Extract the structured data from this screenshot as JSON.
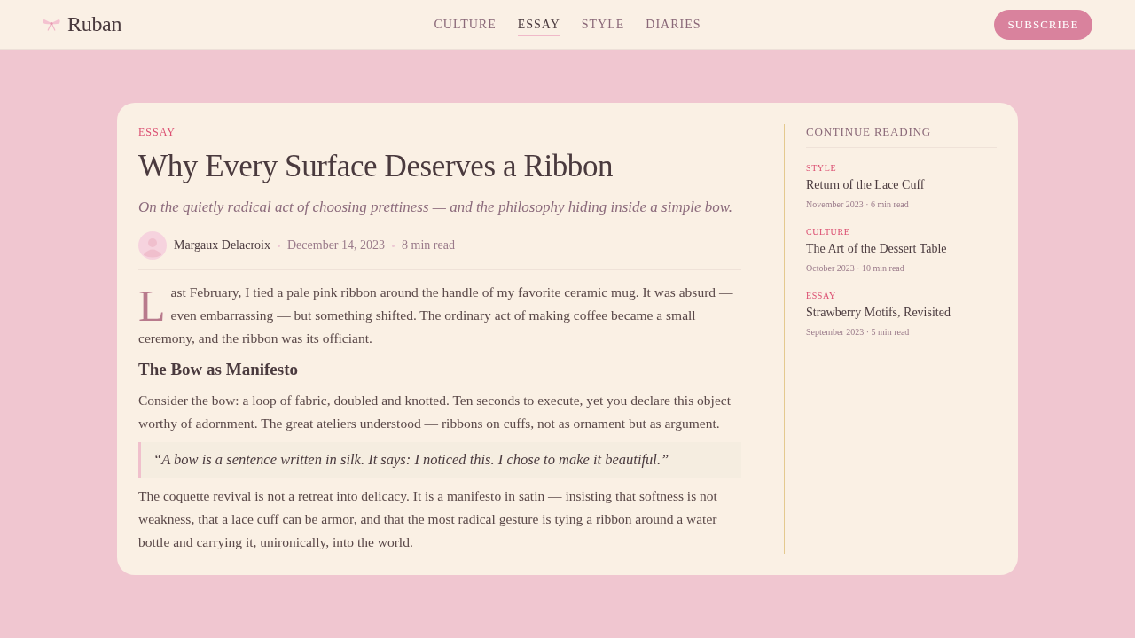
{
  "header": {
    "logo": "Ruban",
    "nav": [
      {
        "label": "CULTURE",
        "selected": false
      },
      {
        "label": "ESSAY",
        "selected": true
      },
      {
        "label": "STYLE",
        "selected": false
      },
      {
        "label": "DIARIES",
        "selected": false
      }
    ],
    "subscribe_button": "SUBSCRIBE"
  },
  "article": {
    "category": "ESSAY",
    "title": "Why Every Surface Deserves a Ribbon",
    "subtitle": "On the quietly radical act of choosing prettiness — and the philosophy hiding inside a simple bow.",
    "byline": {
      "author": "Margaux Delacroix",
      "date": "December 14, 2023",
      "read_time": "8 min read"
    },
    "body": [
      {
        "kind": "paragraph",
        "drop_cap": true,
        "text": "Last February, I tied a pale pink ribbon around the handle of my favorite ceramic mug. It was absurd — even embarrassing — but something shifted. The ordinary act of making coffee became a small ceremony, and the ribbon was its officiant."
      },
      {
        "kind": "heading",
        "drop_cap": false,
        "text": "The Bow as Manifesto"
      },
      {
        "kind": "paragraph",
        "drop_cap": false,
        "text": "Consider the bow: a loop of fabric, doubled and knotted. Ten seconds to execute, yet you declare this object worthy of adornment. The great ateliers understood — ribbons on cuffs, not as ornament but as argument."
      },
      {
        "kind": "quote",
        "drop_cap": false,
        "text": "“A bow is a sentence written in silk. It says: I noticed this. I chose to make it beautiful.”"
      },
      {
        "kind": "paragraph",
        "drop_cap": false,
        "text": "The coquette revival is not a retreat into delicacy. It is a manifesto in satin — insisting that softness is not weakness, that a lace cuff can be armor, and that the most radical gesture is tying a ribbon around a water bottle and carrying it, unironically, into the world."
      }
    ]
  },
  "sidebar": {
    "heading": "CONTINUE READING",
    "articles": [
      {
        "category": "STYLE",
        "title": "Return of the Lace Cuff",
        "meta": "November 2023 · 6 min read"
      },
      {
        "category": "CULTURE",
        "title": "The Art of the Dessert Table",
        "meta": "October 2023 · 10 min read"
      },
      {
        "category": "ESSAY",
        "title": "Strawberry Motifs, Revisited",
        "meta": "September 2023 · 5 min read"
      }
    ]
  }
}
